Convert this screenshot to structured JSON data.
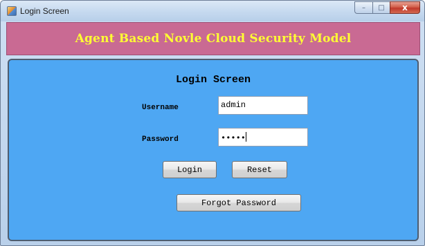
{
  "window": {
    "title": "Login Screen",
    "controls": {
      "minimize": "–",
      "maximize": "□",
      "close": "x"
    },
    "icon": "java-app-icon"
  },
  "header": {
    "title": "Agent Based Novle Cloud Security Model"
  },
  "form": {
    "title": "Login Screen",
    "username_label": "Username",
    "username_value": "admin",
    "password_label": "Password",
    "password_mask": "•••••",
    "login_button": "Login",
    "reset_button": "Reset",
    "forgot_button": "Forgot Password"
  },
  "colors": {
    "header_band": "#c96a93",
    "header_text": "#ffff33",
    "panel": "#4ea7f3"
  }
}
